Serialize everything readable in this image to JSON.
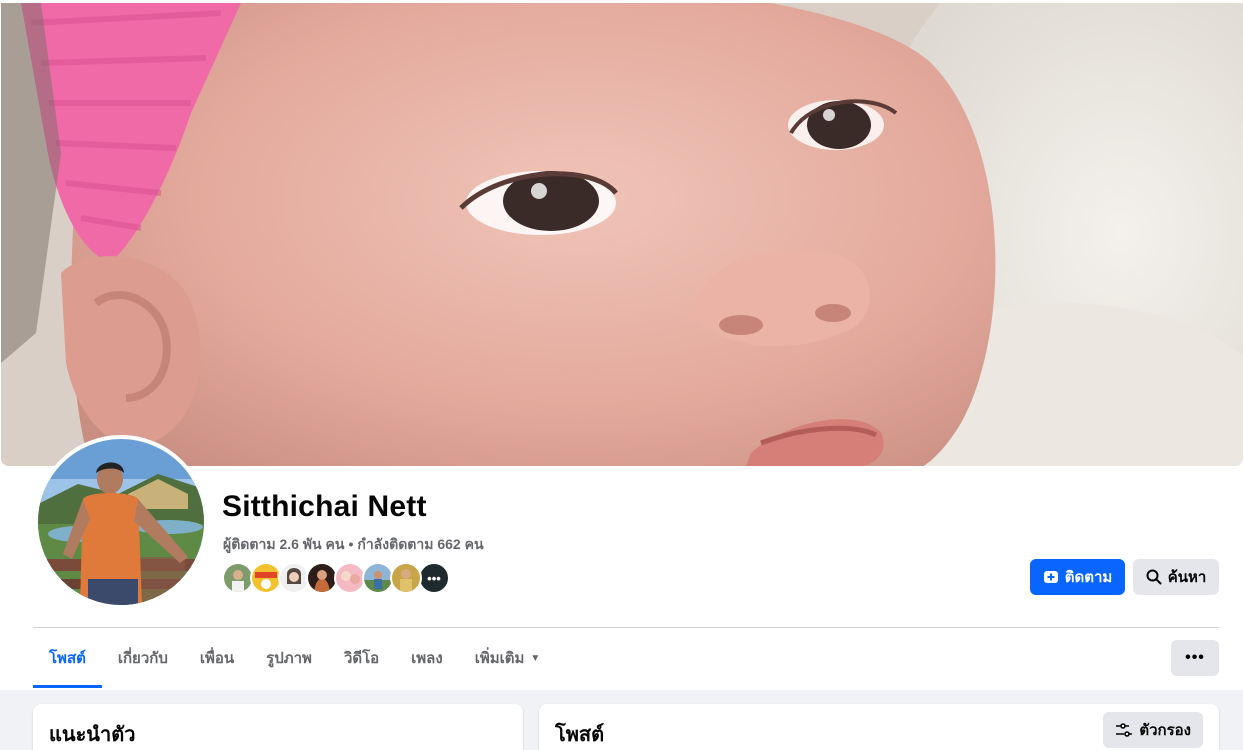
{
  "profile": {
    "name": "Sitthichai Nett",
    "followers": "ผู้ติดตาม 2.6 พัน คน",
    "separator": "•",
    "following": "กำลังติดตาม 662 คน",
    "friend_faces_more": "•••"
  },
  "actions": {
    "follow_label": "ติดตาม",
    "search_label": "ค้นหา",
    "more_label": "•••"
  },
  "tabs": [
    {
      "label": "โพสต์",
      "active": true
    },
    {
      "label": "เกี่ยวกับ",
      "active": false
    },
    {
      "label": "เพื่อน",
      "active": false
    },
    {
      "label": "รูปภาพ",
      "active": false
    },
    {
      "label": "วิดีโอ",
      "active": false
    },
    {
      "label": "เพลง",
      "active": false
    },
    {
      "label": "เพิ่มเติม",
      "active": false
    }
  ],
  "intro_card": {
    "title": "แนะนำตัว"
  },
  "posts_card": {
    "title": "โพสต์",
    "filter_label": "ตัวกรอง"
  },
  "colors": {
    "accent": "#0866ff",
    "secondary_button": "#e4e6eb",
    "muted_text": "#65676b"
  },
  "icons": {
    "follow": "follow-add-icon",
    "search": "search-icon",
    "filter": "filter-sliders-icon",
    "caret": "caret-down-icon",
    "more": "more-dots-icon"
  }
}
